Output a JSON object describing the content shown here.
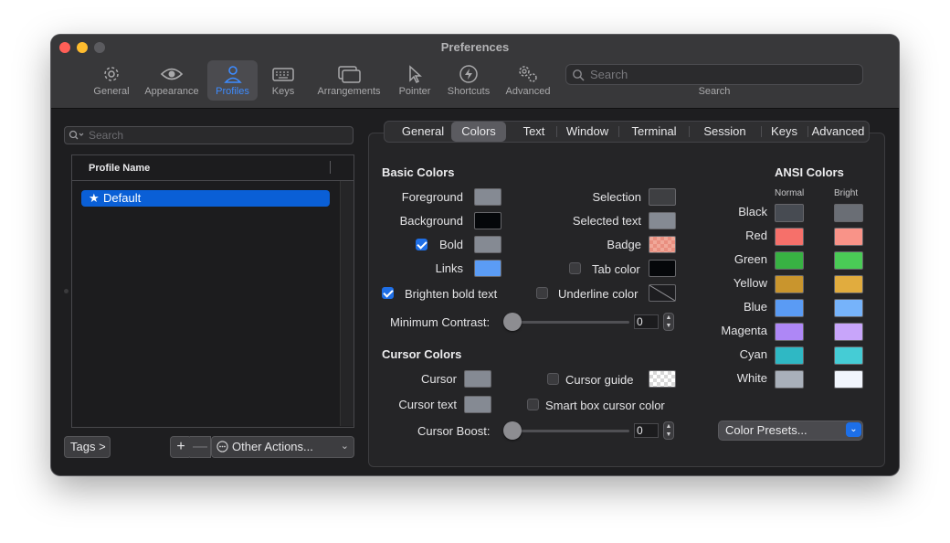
{
  "window": {
    "title": "Preferences"
  },
  "toolbar": {
    "items": [
      {
        "label": "General",
        "icon": "gear-icon"
      },
      {
        "label": "Appearance",
        "icon": "eye-icon"
      },
      {
        "label": "Profiles",
        "icon": "person-icon"
      },
      {
        "label": "Keys",
        "icon": "keyboard-icon"
      },
      {
        "label": "Arrangements",
        "icon": "windows-icon"
      },
      {
        "label": "Pointer",
        "icon": "pointer-icon"
      },
      {
        "label": "Shortcuts",
        "icon": "bolt-icon"
      },
      {
        "label": "Advanced",
        "icon": "gears-icon"
      }
    ],
    "active": "Profiles",
    "search_placeholder": "Search",
    "search_caption": "Search"
  },
  "profiles": {
    "search_placeholder": "Search",
    "column_header": "Profile Name",
    "list": [
      {
        "name": "Default",
        "star": "★",
        "selected": true
      }
    ],
    "tags_label": "Tags >",
    "plus_label": "+",
    "minus_label": "—",
    "other_actions_label": "Other Actions...",
    "other_actions_chevron": "⌄"
  },
  "tabs": {
    "items": [
      "General",
      "Colors",
      "Text",
      "Window",
      "Terminal",
      "Session",
      "Keys",
      "Advanced"
    ],
    "active": "Colors"
  },
  "basic_colors": {
    "heading": "Basic Colors",
    "foreground": {
      "label": "Foreground",
      "color": "#858a93"
    },
    "background": {
      "label": "Background",
      "color": "#05070a"
    },
    "bold": {
      "label": "Bold",
      "checked": true,
      "color": "#858a93"
    },
    "links": {
      "label": "Links",
      "color": "#5b9cf5"
    },
    "selection": {
      "label": "Selection",
      "color": "#3e3f42"
    },
    "selected_text": {
      "label": "Selected text",
      "color": "#858a93"
    },
    "badge": {
      "label": "Badge",
      "color": "#f0a899"
    },
    "tab_color": {
      "label": "Tab color",
      "checked": false,
      "color": "#05070a"
    },
    "brighten_bold": {
      "label": "Brighten bold text",
      "checked": true
    },
    "underline_color": {
      "label": "Underline color",
      "checked": false
    },
    "minimum_contrast": {
      "label": "Minimum Contrast:",
      "value": "0"
    }
  },
  "cursor_colors": {
    "heading": "Cursor Colors",
    "cursor": {
      "label": "Cursor",
      "color": "#858a93"
    },
    "cursor_text": {
      "label": "Cursor text",
      "color": "#858a93"
    },
    "cursor_guide": {
      "label": "Cursor guide",
      "checked": false
    },
    "smart_box": {
      "label": "Smart box cursor color",
      "checked": false
    },
    "cursor_boost": {
      "label": "Cursor Boost:",
      "value": "0"
    }
  },
  "ansi": {
    "heading": "ANSI Colors",
    "normal_label": "Normal",
    "bright_label": "Bright",
    "rows": [
      {
        "name": "Black",
        "normal": "#474b52",
        "bright": "#6a6e75"
      },
      {
        "name": "Red",
        "normal": "#f6706a",
        "bright": "#f99388"
      },
      {
        "name": "Green",
        "normal": "#38b243",
        "bright": "#4acb56"
      },
      {
        "name": "Yellow",
        "normal": "#c9952d",
        "bright": "#e1ac3e"
      },
      {
        "name": "Blue",
        "normal": "#5a9bf4",
        "bright": "#76b3fa"
      },
      {
        "name": "Magenta",
        "normal": "#ae87f6",
        "bright": "#c8a5fa"
      },
      {
        "name": "Cyan",
        "normal": "#2fb8c4",
        "bright": "#45ccd5"
      },
      {
        "name": "White",
        "normal": "#a9b0ba",
        "bright": "#f1f5fc"
      }
    ],
    "presets_label": "Color Presets...",
    "presets_chevron": "⌄"
  }
}
